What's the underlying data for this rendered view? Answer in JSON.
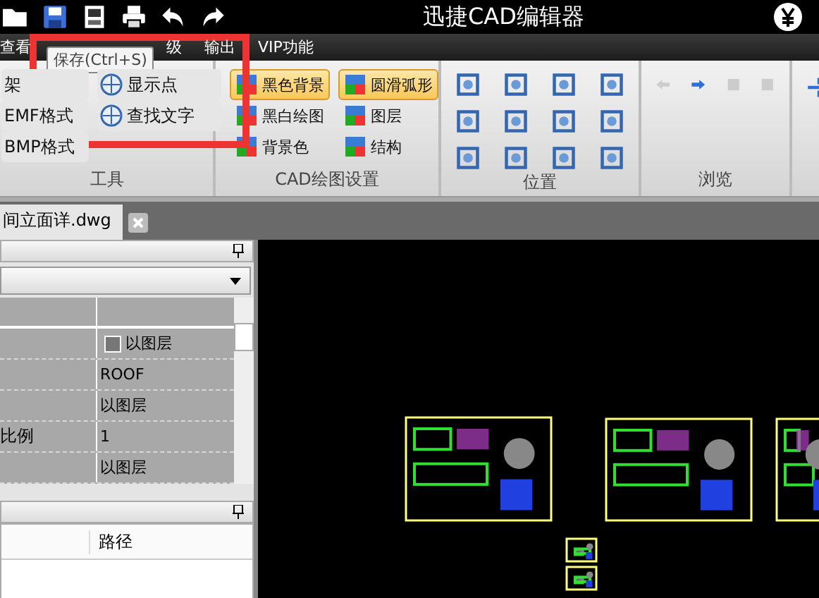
{
  "window": {
    "title": "迅捷CAD编辑器"
  },
  "menu": [
    {
      "label": "查看"
    },
    {
      "label": "级"
    },
    {
      "label": "输出"
    },
    {
      "label": "VIP功能"
    }
  ],
  "tooltip": "保存(Ctrl+S)",
  "ribbon": {
    "groups": [
      {
        "label": "工具",
        "items": [
          {
            "label": "架",
            "kind": "plain",
            "on": false
          },
          {
            "label": "EMF格式",
            "kind": "plain",
            "on": false
          },
          {
            "label": "BMP格式",
            "kind": "plain",
            "on": false
          },
          {
            "label": "显示点",
            "kind": "icon",
            "on": false
          },
          {
            "label": "查找文字",
            "kind": "icon",
            "on": false
          }
        ]
      },
      {
        "label": "CAD绘图设置",
        "items": [
          {
            "label": "黑色背景",
            "kind": "icon",
            "on": true
          },
          {
            "label": "黑白绘图",
            "kind": "icon",
            "on": false
          },
          {
            "label": "背景色",
            "kind": "icon",
            "on": false
          },
          {
            "label": "圆滑弧形",
            "kind": "icon",
            "on": true
          },
          {
            "label": "图层",
            "kind": "icon",
            "on": false
          },
          {
            "label": "结构",
            "kind": "icon",
            "on": false
          }
        ]
      },
      {
        "label": "位置"
      },
      {
        "label": "浏览"
      }
    ]
  },
  "doc_tab": {
    "label": "间立面详.dwg"
  },
  "properties": {
    "rows": [
      {
        "value": "以图层",
        "kind": "swatch"
      },
      {
        "value": "ROOF",
        "kind": "text"
      },
      {
        "value": "以图层",
        "kind": "text"
      },
      {
        "name": "比例",
        "value": "1",
        "kind": "text"
      },
      {
        "value": "以图层",
        "kind": "text"
      }
    ]
  },
  "lower_panel": {
    "columns": [
      "路径"
    ]
  }
}
